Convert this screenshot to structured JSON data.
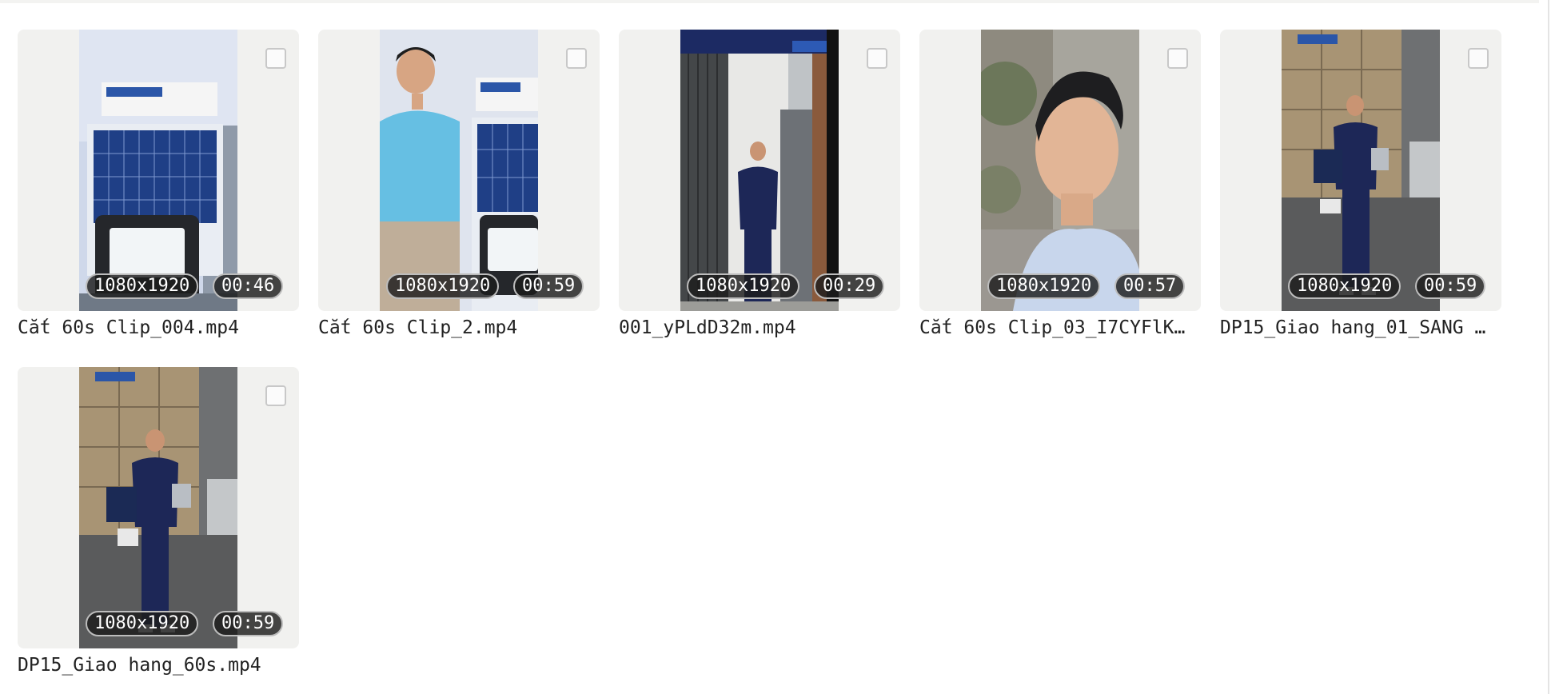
{
  "items": [
    {
      "name": "Cắt 60s Clip_004.mp4",
      "resolution": "1080x1920",
      "duration": "00:46",
      "thumbnail": "solar-panel-product"
    },
    {
      "name": "Cắt 60s Clip_2.mp4",
      "resolution": "1080x1920",
      "duration": "00:59",
      "thumbnail": "presenter-blue-shirt"
    },
    {
      "name": "001_yPLdD32m.mp4",
      "resolution": "1080x1920",
      "duration": "00:29",
      "thumbnail": "man-at-gate"
    },
    {
      "name": "Cắt 60s Clip_03_I7CYFlK…",
      "resolution": "1080x1920",
      "duration": "00:57",
      "thumbnail": "presenter-closeup"
    },
    {
      "name": "DP15_Giao hang_01_SANG …",
      "resolution": "1080x1920",
      "duration": "00:59",
      "thumbnail": "delivery-truck"
    },
    {
      "name": "DP15_Giao hang_60s.mp4",
      "resolution": "1080x1920",
      "duration": "00:59",
      "thumbnail": "delivery-truck"
    }
  ]
}
